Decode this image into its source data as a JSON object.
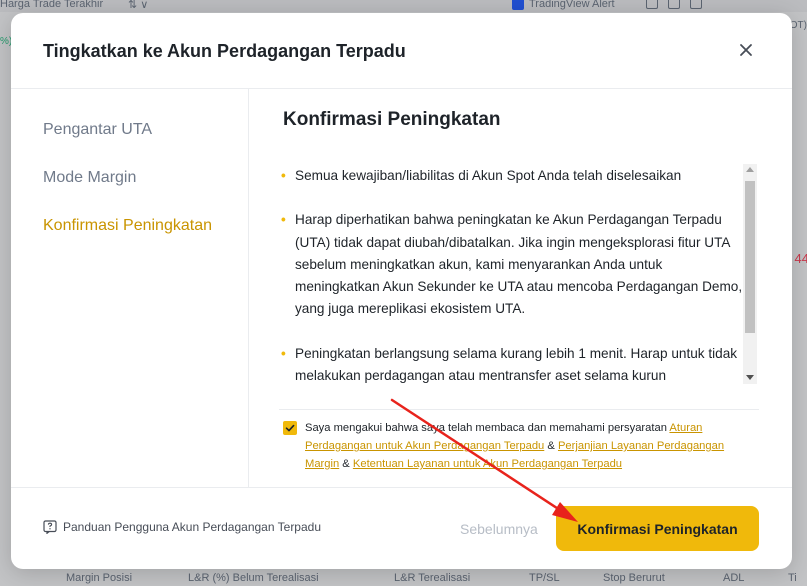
{
  "background": {
    "top_left_text": "Harga Trade Terakhir",
    "top_left_suffix": "⇅ ∨",
    "alert_label": "TradingView Alert",
    "right_header_mark": "(OT)",
    "left_mark": "%)",
    "right_number": "44",
    "bottom_columns": [
      "Margin Posisi",
      "L&R (%) Belum Terealisasi",
      "L&R Terealisasi",
      "TP/SL",
      "Stop Berurut",
      "ADL",
      "Ti"
    ]
  },
  "modal": {
    "title": "Tingkatkan ke Akun Perdagangan Terpadu",
    "close_icon": "close-icon",
    "sidebar": {
      "items": [
        {
          "label": "Pengantar UTA",
          "active": false
        },
        {
          "label": "Mode Margin",
          "active": false
        },
        {
          "label": "Konfirmasi Peningkatan",
          "active": true
        }
      ]
    },
    "content_title": "Konfirmasi Peningkatan",
    "bullets": [
      "Semua kewajiban/liabilitas di Akun Spot Anda telah diselesaikan",
      "Harap diperhatikan bahwa peningkatan ke Akun Perdagangan Terpadu (UTA) tidak dapat diubah/dibatalkan. Jika ingin mengeksplorasi fitur UTA sebelum meningkatkan akun, kami menyarankan Anda untuk meningkatkan Akun Sekunder ke UTA atau mencoba Perdagangan Demo, yang juga mereplikasi ekosistem UTA.",
      "Peningkatan berlangsung selama kurang lebih 1 menit. Harap untuk tidak melakukan perdagangan atau mentransfer aset selama kurun"
    ],
    "agreement": {
      "checked": true,
      "prefix": "Saya mengakui bahwa saya telah membaca dan memahami persyaratan ",
      "link1": "Aturan Perdagangan untuk Akun Perdagangan Terpadu",
      "sep1": " & ",
      "link2": "Perjanjian Layanan Perdagangan Margin",
      "sep2": " & ",
      "link3": "Ketentuan Layanan untuk Akun Perdagangan Terpadu"
    },
    "footer": {
      "guide_label": "Panduan Pengguna Akun Perdagangan Terpadu",
      "guide_icon": "question-icon",
      "prev_label": "Sebelumnya",
      "confirm_label": "Konfirmasi Peningkatan"
    }
  },
  "colors": {
    "accent": "#f0b90b",
    "link": "#c99400",
    "annotation_arrow": "#e8231c"
  }
}
